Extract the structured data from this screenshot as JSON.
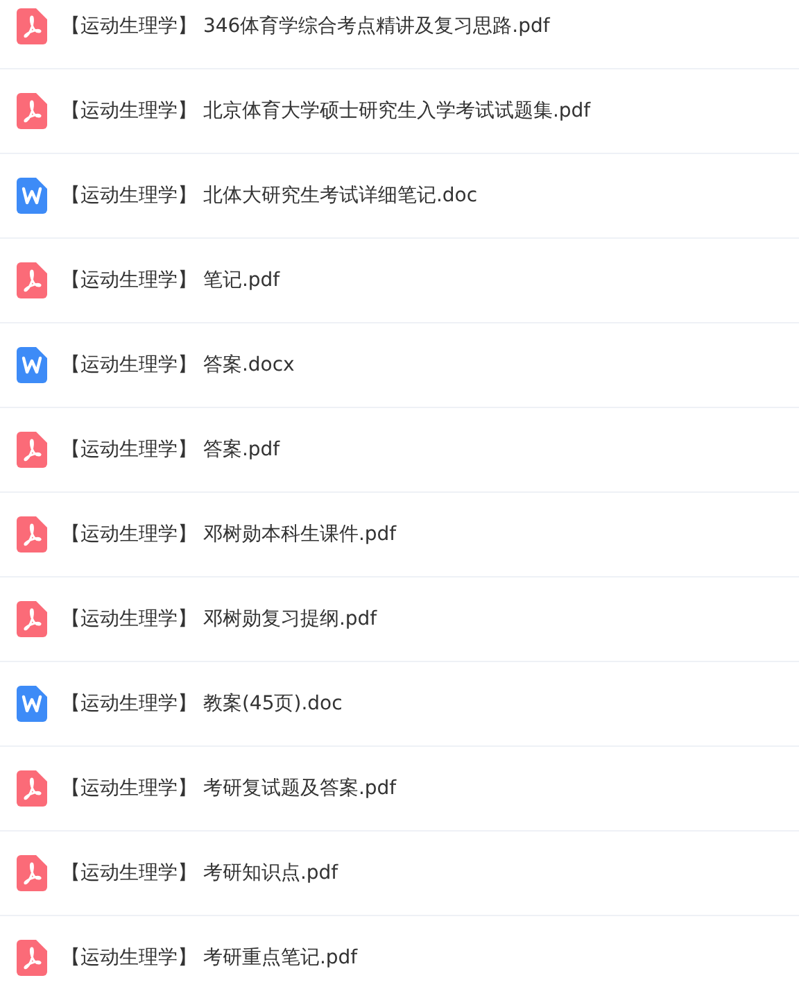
{
  "files": [
    {
      "kind": "pdf",
      "name": "【运动生理学】 346体育学综合考点精讲及复习思路.pdf"
    },
    {
      "kind": "pdf",
      "name": "【运动生理学】 北京体育大学硕士研究生入学考试试题集.pdf"
    },
    {
      "kind": "doc",
      "name": "【运动生理学】 北体大研究生考试详细笔记.doc"
    },
    {
      "kind": "pdf",
      "name": "【运动生理学】 笔记.pdf"
    },
    {
      "kind": "doc",
      "name": "【运动生理学】 答案.docx"
    },
    {
      "kind": "pdf",
      "name": "【运动生理学】 答案.pdf"
    },
    {
      "kind": "pdf",
      "name": "【运动生理学】 邓树勋本科生课件.pdf"
    },
    {
      "kind": "pdf",
      "name": "【运动生理学】 邓树勋复习提纲.pdf"
    },
    {
      "kind": "doc",
      "name": "【运动生理学】 教案(45页).doc"
    },
    {
      "kind": "pdf",
      "name": "【运动生理学】 考研复试题及答案.pdf"
    },
    {
      "kind": "pdf",
      "name": "【运动生理学】 考研知识点.pdf"
    },
    {
      "kind": "pdf",
      "name": "【运动生理学】 考研重点笔记.pdf"
    }
  ]
}
